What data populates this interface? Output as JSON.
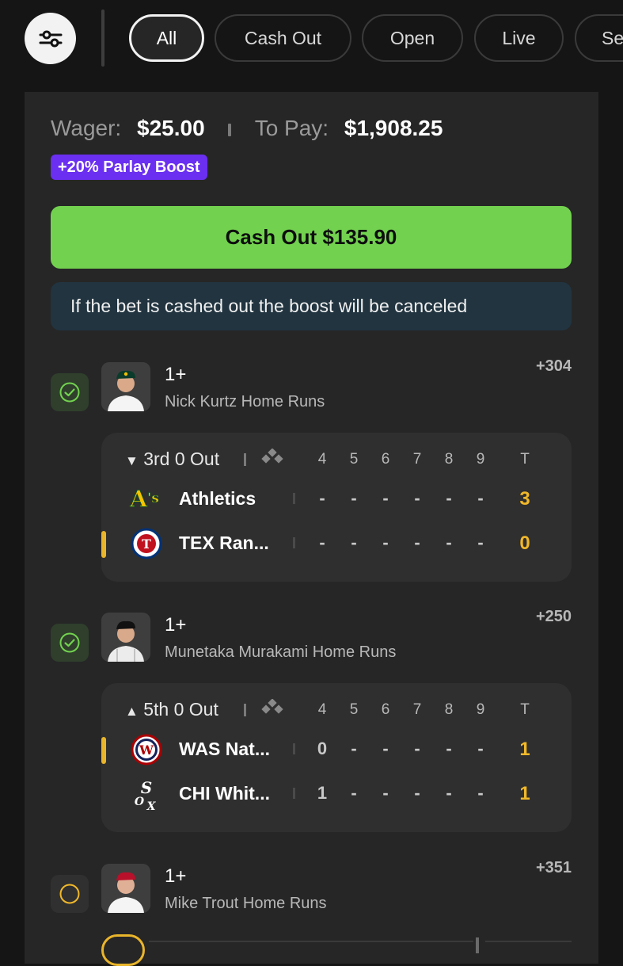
{
  "filters": {
    "tabs": [
      {
        "label": "All",
        "active": true
      },
      {
        "label": "Cash Out",
        "active": false
      },
      {
        "label": "Open",
        "active": false
      },
      {
        "label": "Live",
        "active": false
      },
      {
        "label": "Se",
        "active": false
      }
    ],
    "filter_icon": "sliders-icon"
  },
  "bet": {
    "wager_label": "Wager:",
    "wager_value": "$25.00",
    "topay_label": "To Pay:",
    "topay_value": "$1,908.25",
    "boost_badge": "+20% Parlay Boost",
    "cashout_label": "Cash Out $135.90",
    "notice": "If the bet is cashed out the boost will be canceled"
  },
  "legs": [
    {
      "line": "1+",
      "name": "Nick Kurtz Home Runs",
      "odds": "+304",
      "status": "won",
      "game": {
        "arrow": "▼",
        "inning": "3rd 0 Out",
        "columns": [
          "4",
          "5",
          "6",
          "7",
          "8",
          "9"
        ],
        "total_header": "T",
        "teams": [
          {
            "name": "Athletics",
            "scores": [
              "-",
              "-",
              "-",
              "-",
              "-",
              "-"
            ],
            "total": "3",
            "batting": false
          },
          {
            "name": "TEX Ran...",
            "scores": [
              "-",
              "-",
              "-",
              "-",
              "-",
              "-"
            ],
            "total": "0",
            "batting": true
          }
        ]
      }
    },
    {
      "line": "1+",
      "name": "Munetaka Murakami Home Runs",
      "odds": "+250",
      "status": "won",
      "game": {
        "arrow": "▲",
        "inning": "5th 0 Out",
        "columns": [
          "4",
          "5",
          "6",
          "7",
          "8",
          "9"
        ],
        "total_header": "T",
        "teams": [
          {
            "name": "WAS Nat...",
            "scores": [
              "0",
              "-",
              "-",
              "-",
              "-",
              "-"
            ],
            "total": "1",
            "batting": true
          },
          {
            "name": "CHI Whit...",
            "scores": [
              "1",
              "-",
              "-",
              "-",
              "-",
              "-"
            ],
            "total": "1",
            "batting": false
          }
        ]
      }
    },
    {
      "line": "1+",
      "name": "Mike Trout Home Runs",
      "odds": "+351",
      "status": "pending"
    }
  ],
  "colors": {
    "accent_green": "#72d24f",
    "boost_purple": "#6a2ff0",
    "score_gold": "#f0b82a",
    "notice_bg": "#213440"
  }
}
